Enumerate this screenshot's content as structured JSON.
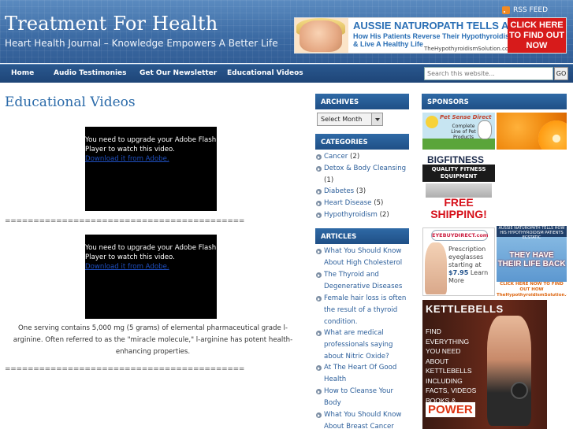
{
  "header": {
    "title": "Treatment For Health",
    "tagline": "Heart Health Journal – Knowledge Empowers A Better Life",
    "rss_label": "RSS FEED",
    "rss_icon": "rss-icon",
    "ad": {
      "line1": "AUSSIE NATUROPATH TELLS ALL",
      "line2a": "How His Patients Reverse Their Hypothyroidism",
      "line2b": "& Live A Healthy Life",
      "url": "TheHypothyroidismSolution.com",
      "cta": "CLICK HERE TO FIND OUT NOW"
    }
  },
  "nav": {
    "items": [
      "Home",
      "Audio Testimonies",
      "Get Our Newsletter",
      "Educational Videos"
    ],
    "search_placeholder": "Search this website...",
    "search_button": "GO"
  },
  "main": {
    "page_title": "Educational Videos",
    "flash_message": "You need to upgrade your Adobe Flash Player to watch this video.",
    "flash_link": "Download it from Adobe.",
    "separator": "==========================================",
    "body_text": "One serving contains 5,000 mg (5 grams) of elemental pharmaceutical grade l-arginine. Often referred to as the \"miracle molecule,\" l-arginine has potent health-enhancing properties."
  },
  "sidebar": {
    "archives": {
      "title": "ARCHIVES",
      "select_value": "Select Month"
    },
    "categories": {
      "title": "CATEGORIES",
      "items": [
        {
          "label": "Cancer",
          "count": "(2)"
        },
        {
          "label": "Detox & Body Cleansing",
          "count": "(1)"
        },
        {
          "label": "Diabetes",
          "count": "(3)"
        },
        {
          "label": "Heart Disease",
          "count": "(5)"
        },
        {
          "label": "Hypothyroidism",
          "count": "(2)"
        }
      ]
    },
    "articles": {
      "title": "ARTICLES",
      "items": [
        "What You Should Know About High Cholesterol",
        "The Thyroid and Degenerative Diseases",
        "Female hair loss is often the result of a thyroid condition.",
        "What are medical professionals saying about Nitric Oxide?",
        "At The Heart Of Good Health",
        "How to Cleanse Your Body",
        "What You Should Know About Breast Cancer"
      ]
    },
    "sponsors": {
      "title": "SPONSORS",
      "pet_logo": "Pet Sense Direct",
      "pet_text": "Complete Line of Pet Products",
      "fitness_brand": "BIGFITNESS",
      "fitness_band": "QUALITY FITNESS EQUIPMENT",
      "fitness_free": "FREE SHIPPING!",
      "eye_logo": "EYEBUYDIRECT.com",
      "eye_text1": "Prescription eyeglasses starting at",
      "eye_price": "$7.95",
      "eye_more": "Learn More",
      "thyroid_top": "AUSSIE NATUROPATH TELLS HOW HIS HYPOTHYROIDISM PATIENTS ECSTATIC",
      "thyroid_mid": "THEY HAVE THEIR LIFE BACK",
      "thyroid_bot": "CLICK HERE NOW TO FIND OUT HOW TheHypothyroidismSolution.com",
      "kettle_head": "KETTLEBELLS",
      "kettle_text": "FIND EVERYTHING YOU NEED ABOUT KETTLEBELLS INCLUDING FACTS, VIDEOS BOOKS & ACCESSORIES",
      "kettle_brand": "POWER"
    }
  }
}
